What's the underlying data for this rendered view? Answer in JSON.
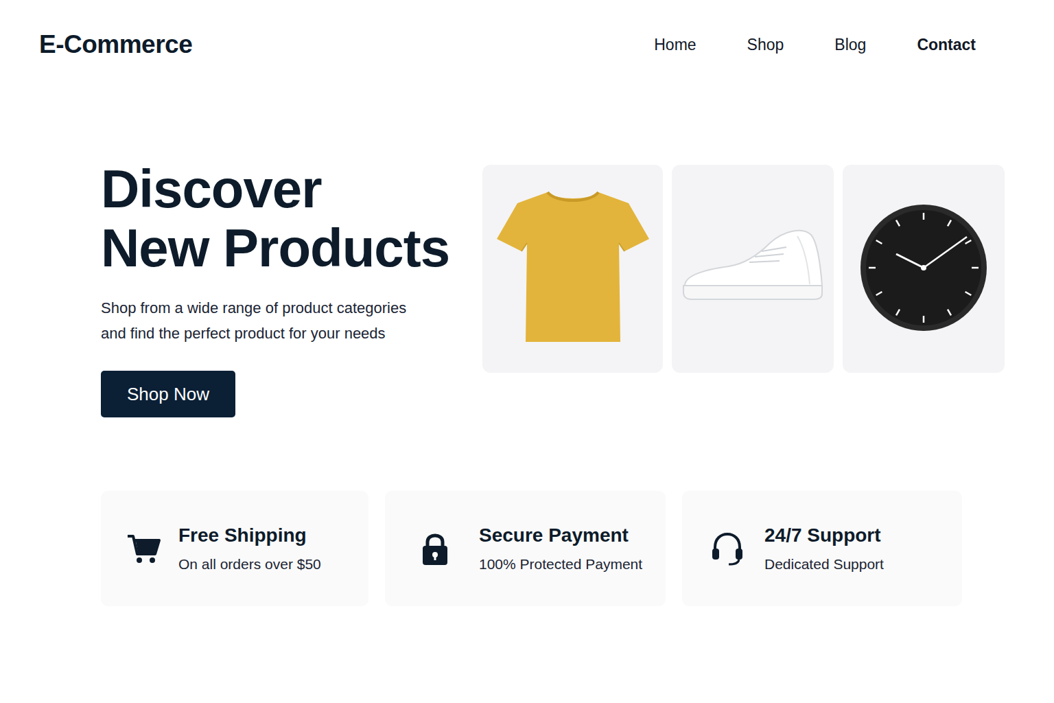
{
  "logo": "E-Commerce",
  "nav": [
    {
      "label": "Home",
      "selected": false
    },
    {
      "label": "Shop",
      "selected": false
    },
    {
      "label": "Blog",
      "selected": false
    },
    {
      "label": "Contact",
      "selected": true
    }
  ],
  "hero": {
    "title_lines": [
      "Discover",
      "New Products"
    ],
    "subtitle_lines": [
      "Shop from a wide range of product categories",
      "and find the perfect product for your needs"
    ],
    "button": "Shop Now"
  },
  "products": [
    {
      "kind": "tshirt"
    },
    {
      "kind": "sneaker"
    },
    {
      "kind": "clock"
    }
  ],
  "features": [
    {
      "kind": "cart",
      "title": "Free Shipping",
      "text": "On all orders over $50"
    },
    {
      "kind": "lock",
      "title": "Secure Payment",
      "text": "100% Protected Payment"
    },
    {
      "kind": "headset",
      "title": "24/7 Support",
      "text": "Dedicated Support"
    }
  ]
}
